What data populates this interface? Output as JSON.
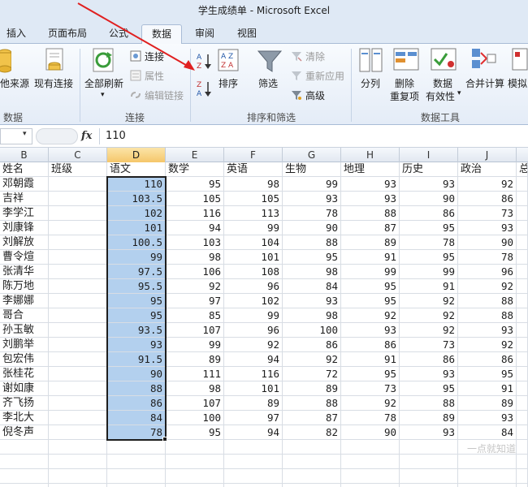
{
  "window": {
    "title": "学生成绩单 - Microsoft Excel"
  },
  "tabs": [
    {
      "label": "插入"
    },
    {
      "label": "页面布局"
    },
    {
      "label": "公式"
    },
    {
      "label": "数据",
      "active": true
    },
    {
      "label": "审阅"
    },
    {
      "label": "视图"
    }
  ],
  "ribbon": {
    "get_external": {
      "from_other": "他来源",
      "existing_connections": "现有连接",
      "group_label": "数据"
    },
    "connections": {
      "refresh_all": "全部刷新",
      "connections": "连接",
      "properties": "属性",
      "edit_links": "编辑链接",
      "group_label": "连接"
    },
    "sort_filter": {
      "sort": "排序",
      "filter": "筛选",
      "clear": "清除",
      "reapply": "重新应用",
      "advanced": "高级",
      "group_label": "排序和筛选"
    },
    "data_tools": {
      "text_to_columns": "分列",
      "remove_duplicates_1": "删除",
      "remove_duplicates_2": "重复项",
      "validation_1": "数据",
      "validation_2": "有效性",
      "consolidate": "合并计算",
      "what_if": "模拟",
      "group_label": "数据工具"
    }
  },
  "formula_bar": {
    "fx": "fx",
    "value": "110"
  },
  "columns": [
    "B",
    "C",
    "D",
    "E",
    "F",
    "G",
    "H",
    "I",
    "J"
  ],
  "header_row": [
    "姓名",
    "班级",
    "语文",
    "数学",
    "英语",
    "生物",
    "地理",
    "历史",
    "政治",
    "总"
  ],
  "rows": [
    [
      "邓朝霞",
      "",
      "110",
      "95",
      "98",
      "99",
      "93",
      "93",
      "92"
    ],
    [
      "吉祥",
      "",
      "103.5",
      "105",
      "105",
      "93",
      "93",
      "90",
      "86"
    ],
    [
      "李学江",
      "",
      "102",
      "116",
      "113",
      "78",
      "88",
      "86",
      "73"
    ],
    [
      "刘康锋",
      "",
      "101",
      "94",
      "99",
      "90",
      "87",
      "95",
      "93"
    ],
    [
      "刘解放",
      "",
      "100.5",
      "103",
      "104",
      "88",
      "89",
      "78",
      "90"
    ],
    [
      "曹令煊",
      "",
      "99",
      "98",
      "101",
      "95",
      "91",
      "95",
      "78"
    ],
    [
      "张清华",
      "",
      "97.5",
      "106",
      "108",
      "98",
      "99",
      "99",
      "96"
    ],
    [
      "陈万地",
      "",
      "95.5",
      "92",
      "96",
      "84",
      "95",
      "91",
      "92"
    ],
    [
      "李娜娜",
      "",
      "95",
      "97",
      "102",
      "93",
      "95",
      "92",
      "88"
    ],
    [
      "哥合",
      "",
      "95",
      "85",
      "99",
      "98",
      "92",
      "92",
      "88"
    ],
    [
      "孙玉敏",
      "",
      "93.5",
      "107",
      "96",
      "100",
      "93",
      "92",
      "93"
    ],
    [
      "刘鹏举",
      "",
      "93",
      "99",
      "92",
      "86",
      "86",
      "73",
      "92"
    ],
    [
      "包宏伟",
      "",
      "91.5",
      "89",
      "94",
      "92",
      "91",
      "86",
      "86"
    ],
    [
      "张桂花",
      "",
      "90",
      "111",
      "116",
      "72",
      "95",
      "93",
      "95"
    ],
    [
      "谢如康",
      "",
      "88",
      "98",
      "101",
      "89",
      "73",
      "95",
      "91"
    ],
    [
      "齐飞扬",
      "",
      "86",
      "107",
      "89",
      "88",
      "92",
      "88",
      "89"
    ],
    [
      "李北大",
      "",
      "84",
      "100",
      "97",
      "87",
      "78",
      "89",
      "93"
    ],
    [
      "倪冬声",
      "",
      "78",
      "95",
      "94",
      "82",
      "90",
      "93",
      "84"
    ]
  ],
  "watermark": "一点就知道",
  "colors": {
    "accent": "#b3d0ee",
    "arrow": "#e02020",
    "selected_header": "#f5c76a"
  }
}
